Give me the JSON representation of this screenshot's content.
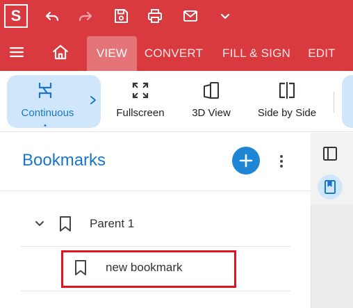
{
  "app": {
    "logo_letter": "S",
    "quick_access": [
      "undo-icon",
      "redo-icon",
      "save-icon",
      "print-icon",
      "mail-icon",
      "chevron-down-icon"
    ]
  },
  "tabs": [
    {
      "label": "VIEW",
      "active": true
    },
    {
      "label": "CONVERT",
      "active": false
    },
    {
      "label": "FILL & SIGN",
      "active": false
    },
    {
      "label": "EDIT",
      "active": false
    }
  ],
  "ribbon": {
    "continuous": "Continuous",
    "fullscreen": "Fullscreen",
    "view3d": "3D View",
    "side_by_side": "Side by Side"
  },
  "bookmarks": {
    "title": "Bookmarks",
    "items": [
      {
        "label": "Parent 1",
        "level": 0,
        "expanded": true
      },
      {
        "label": "new bookmark",
        "level": 1
      }
    ]
  },
  "colors": {
    "brand_red": "#d93a40",
    "active_tab": "#e57479",
    "accent_blue": "#1976c9",
    "selection_bg": "#cfe6fb",
    "highlight_red": "#e0141e"
  }
}
